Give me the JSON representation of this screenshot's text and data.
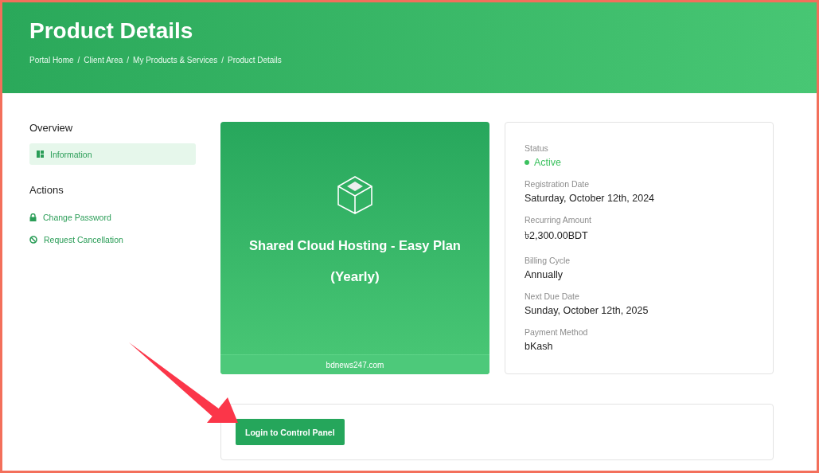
{
  "header": {
    "title": "Product Details",
    "separator": "/",
    "breadcrumb": [
      "Portal Home",
      "Client Area",
      "My Products & Services",
      "Product Details"
    ]
  },
  "sidebar": {
    "sections": [
      {
        "heading": "Overview",
        "items": [
          {
            "label": "Information",
            "kind": "dashboard",
            "selected": true
          }
        ]
      },
      {
        "heading": "Actions",
        "items": [
          {
            "label": "Change Password",
            "kind": "lock",
            "selected": false
          },
          {
            "label": "Request Cancellation",
            "kind": "ban",
            "selected": false
          }
        ]
      }
    ]
  },
  "product": {
    "name": "Shared Cloud Hosting - Easy Plan",
    "term": "(Yearly)",
    "domain": "bdnews247.com"
  },
  "details": [
    {
      "label": "Status",
      "value": "Active",
      "kind": "status",
      "color": "#3cc15f"
    },
    {
      "label": "Registration Date",
      "value": "Saturday, October 12th, 2024",
      "kind": "text"
    },
    {
      "label": "Recurring Amount",
      "value": "৳2,300.00BDT",
      "kind": "text"
    },
    {
      "label": "Billing Cycle",
      "value": "Annually",
      "kind": "text"
    },
    {
      "label": "Next Due Date",
      "value": "Sunday, October 12th, 2025",
      "kind": "text"
    },
    {
      "label": "Payment Method",
      "value": "bKash",
      "kind": "text"
    }
  ],
  "action_button": "Login to Control Panel"
}
